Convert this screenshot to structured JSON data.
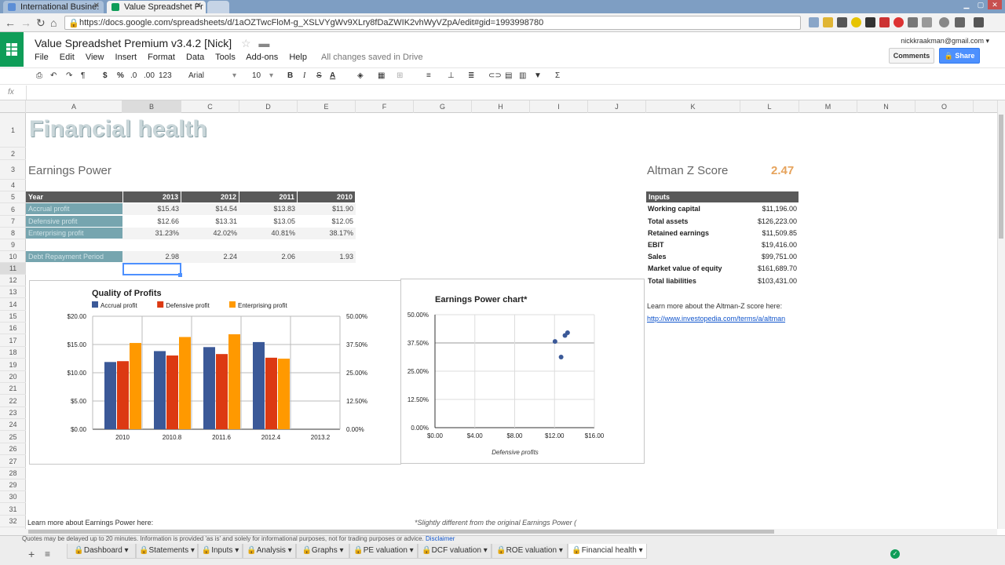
{
  "browser": {
    "tabs": [
      {
        "label": "International Busine:",
        "icon": "site-icon"
      },
      {
        "label": "Value Spreadshet Pr",
        "icon": "sheets-icon"
      }
    ],
    "url": "https://docs.google.com/spreadsheets/d/1aOZTwcFloM-g_XSLVYgWv9XLry8fDaZWIK2vhWyVZpA/edit#gid=1993998780"
  },
  "sheets": {
    "title": "Value Spreadshet Premium v3.4.2 [Nick]",
    "menu": [
      "File",
      "Edit",
      "View",
      "Insert",
      "Format",
      "Data",
      "Tools",
      "Add-ons",
      "Help"
    ],
    "save_status": "All changes saved in Drive",
    "account": "nickkraakman@gmail.com",
    "comments_label": "Comments",
    "share_label": "Share",
    "toolbar": {
      "dollar": "$",
      "percent": "%",
      "dec_less": ".0",
      "dec_more": ".00",
      "format123": "123",
      "font": "Arial",
      "size": "10",
      "bold": "B",
      "italic": "I",
      "strike": "S",
      "textcolor": "A",
      "sigma": "Σ"
    },
    "fx_label": "fx"
  },
  "columns": [
    "A",
    "B",
    "C",
    "D",
    "E",
    "F",
    "G",
    "H",
    "I",
    "J",
    "K",
    "L",
    "M",
    "N",
    "O"
  ],
  "rows": [
    "1",
    "2",
    "3",
    "4",
    "5",
    "6",
    "7",
    "8",
    "9",
    "10",
    "11",
    "12",
    "13",
    "14",
    "15",
    "16",
    "17",
    "18",
    "19",
    "20",
    "21",
    "22",
    "23",
    "24",
    "25",
    "26",
    "27",
    "28",
    "29",
    "30",
    "31",
    "32"
  ],
  "content": {
    "title": "Financial health",
    "earnings_heading": "Earnings Power",
    "table": {
      "header": [
        "Year",
        "2013",
        "2012",
        "2011",
        "2010"
      ],
      "rows": [
        {
          "label": "Accrual profit",
          "values": [
            "$15.43",
            "$14.54",
            "$13.83",
            "$11.90"
          ]
        },
        {
          "label": "Defensive profit",
          "values": [
            "$12.66",
            "$13.31",
            "$13.05",
            "$12.05"
          ]
        },
        {
          "label": "Enterprising profit",
          "values": [
            "31.23%",
            "42.02%",
            "40.81%",
            "38.17%"
          ]
        }
      ],
      "debt_row": {
        "label": "Debt Repayment Period",
        "values": [
          "2.98",
          "2.24",
          "2.06",
          "1.93"
        ]
      }
    },
    "altman": {
      "heading": "Altman Z Score",
      "score": "2.47",
      "inputs_label": "Inputs",
      "items": [
        {
          "label": "Working capital",
          "value": "$11,196.00"
        },
        {
          "label": "Total assets",
          "value": "$126,223.00"
        },
        {
          "label": "Retained earnings",
          "value": "$11,509.85"
        },
        {
          "label": "EBIT",
          "value": "$19,416.00"
        },
        {
          "label": "Sales",
          "value": "$99,751.00"
        },
        {
          "label": "Market value of equity",
          "value": "$161,689.70"
        },
        {
          "label": "Total liabilities",
          "value": "$103,431.00"
        }
      ],
      "learn_text": "Learn more about the Altman-Z score here:",
      "learn_link": "http://www.investopedia.com/terms/a/altman"
    },
    "footer_left": "Learn more about Earnings Power here:",
    "footer_right": "*Slightly different from the original Earnings Power ("
  },
  "chart_data": [
    {
      "type": "bar",
      "title": "Quality of Profits",
      "categories": [
        "2010",
        "2010.8",
        "2011.6",
        "2012.4",
        "2013.2"
      ],
      "series": [
        {
          "name": "Accrual profit",
          "color": "#3b5998",
          "axis": "left",
          "values": [
            11.9,
            13.83,
            14.54,
            15.43
          ]
        },
        {
          "name": "Defensive profit",
          "color": "#dc3912",
          "axis": "left",
          "values": [
            12.05,
            13.05,
            13.31,
            12.66
          ]
        },
        {
          "name": "Enterprising profit",
          "color": "#ff9900",
          "axis": "right",
          "values": [
            38.17,
            40.81,
            42.02,
            31.23
          ]
        }
      ],
      "left_ticks": [
        "$0.00",
        "$5.00",
        "$10.00",
        "$15.00",
        "$20.00"
      ],
      "right_ticks": [
        "0.00%",
        "12.50%",
        "25.00%",
        "37.50%",
        "50.00%"
      ],
      "ylim_left": [
        0,
        20
      ],
      "ylim_right": [
        0,
        50
      ],
      "legend": "top",
      "grid": true
    },
    {
      "type": "scatter",
      "title": "Earnings Power chart*",
      "xlabel": "Defensive profits",
      "points": [
        {
          "x": 12.05,
          "y": 38.17
        },
        {
          "x": 13.05,
          "y": 40.81
        },
        {
          "x": 13.31,
          "y": 42.02
        },
        {
          "x": 12.66,
          "y": 31.23
        }
      ],
      "x_ticks": [
        "$0.00",
        "$4.00",
        "$8.00",
        "$12.00",
        "$16.00"
      ],
      "y_ticks": [
        "0.00%",
        "12.50%",
        "25.00%",
        "37.50%",
        "50.00%"
      ],
      "xlim": [
        0,
        16
      ],
      "ylim": [
        0,
        50
      ],
      "color": "#3b5998",
      "grid": true
    }
  ],
  "disclaimer": {
    "text": "Quotes may be delayed up to 20 minutes. Information is provided 'as is' and solely for informational purposes, not for trading purposes or advice.",
    "link": "Disclaimer"
  },
  "sheet_tabs": [
    "Dashboard",
    "Statements",
    "Inputs",
    "Analysis",
    "Graphs",
    "PE valuation",
    "DCF valuation",
    "ROE valuation",
    "Financial health"
  ]
}
